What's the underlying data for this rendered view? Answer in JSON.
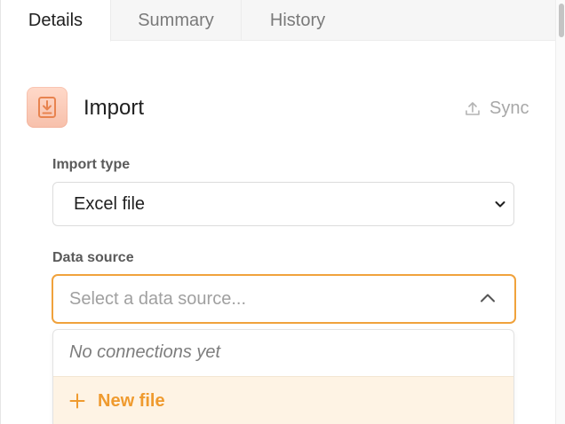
{
  "tabs": {
    "details": "Details",
    "summary": "Summary",
    "history": "History",
    "active": "details"
  },
  "header": {
    "title": "Import",
    "icon": "import-document-icon",
    "sync_label": "Sync",
    "sync_icon": "upload-icon"
  },
  "form": {
    "import_type": {
      "label": "Import type",
      "value": "Excel file",
      "icon": "chevron-down-icon"
    },
    "data_source": {
      "label": "Data source",
      "placeholder": "Select a data source...",
      "value": "",
      "icon": "chevron-up-icon",
      "dropdown": {
        "empty_message": "No connections yet",
        "new_label": "New file",
        "new_icon": "plus-icon"
      }
    }
  },
  "colors": {
    "accent": "#f0a23c",
    "accent_text": "#ef9a2e",
    "icon_bg": "#f7c0ab",
    "highlight_bg": "#fef3e4"
  }
}
